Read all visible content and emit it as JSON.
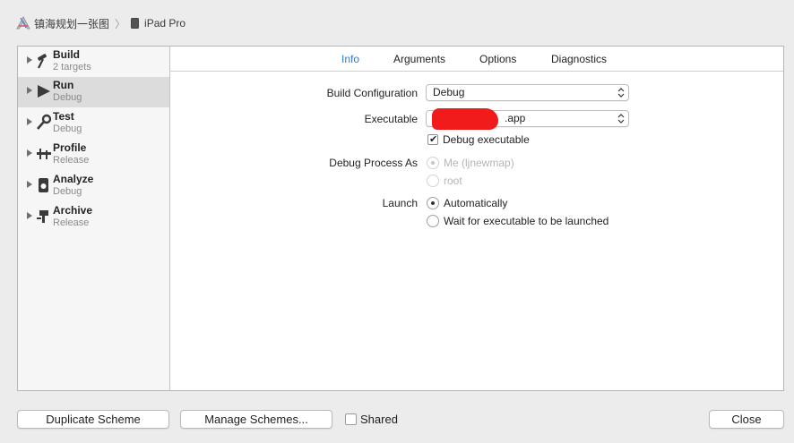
{
  "breadcrumb": {
    "project": "镇海规划一张图",
    "device": "iPad Pro"
  },
  "sidebar": {
    "items": [
      {
        "title": "Build",
        "subtitle": "2 targets",
        "icon": "hammer-icon"
      },
      {
        "title": "Run",
        "subtitle": "Debug",
        "icon": "play-icon"
      },
      {
        "title": "Test",
        "subtitle": "Debug",
        "icon": "wrench-icon"
      },
      {
        "title": "Profile",
        "subtitle": "Release",
        "icon": "instruments-icon"
      },
      {
        "title": "Analyze",
        "subtitle": "Debug",
        "icon": "analyze-icon"
      },
      {
        "title": "Archive",
        "subtitle": "Release",
        "icon": "archive-icon"
      }
    ],
    "selected": "Run"
  },
  "tabs": [
    {
      "label": "Info",
      "active": true
    },
    {
      "label": "Arguments",
      "active": false
    },
    {
      "label": "Options",
      "active": false
    },
    {
      "label": "Diagnostics",
      "active": false
    }
  ],
  "form": {
    "build_config_label": "Build Configuration",
    "build_config_value": "Debug",
    "executable_label": "Executable",
    "executable_value": ".app",
    "debug_exe_label": "Debug executable",
    "debug_exe_checked": true,
    "debug_process_label": "Debug Process As",
    "debug_process_options": [
      "Me (ljnewmap)",
      "root"
    ],
    "launch_label": "Launch",
    "launch_options": [
      "Automatically",
      "Wait for executable to be launched"
    ],
    "launch_selected": "Automatically"
  },
  "footer": {
    "duplicate_label": "Duplicate Scheme",
    "manage_label": "Manage Schemes...",
    "shared_label": "Shared",
    "close_label": "Close"
  },
  "colors": {
    "accent": "#2f7ae5",
    "redaction": "#f21b1b"
  }
}
